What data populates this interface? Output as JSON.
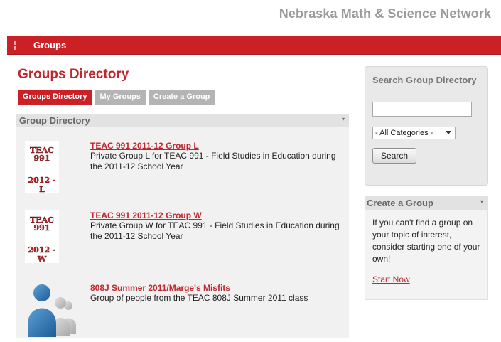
{
  "site": {
    "title": "Nebraska Math & Science Network"
  },
  "nav": {
    "item": "Groups"
  },
  "page": {
    "title": "Groups Directory"
  },
  "tabs": [
    {
      "label": "Groups Directory",
      "active": true
    },
    {
      "label": "My Groups",
      "active": false
    },
    {
      "label": "Create a Group",
      "active": false
    }
  ],
  "directory": {
    "heading": "Group Directory",
    "toggle": "▾",
    "groups": [
      {
        "name": "TEAC 991 2011-12 Group L",
        "description": "Private Group L for TEAC 991 - Field Studies in Education during the 2011-12 School Year",
        "thumb": {
          "line1": "TEAC",
          "line2": "991",
          "line3": "2012 - L"
        }
      },
      {
        "name": "TEAC 991 2011-12 Group W",
        "description": "Private Group W for TEAC 991 - Field Studies in Education during the 2011-12 School Year",
        "thumb": {
          "line1": "TEAC",
          "line2": "991",
          "line3": "2012 - W"
        }
      },
      {
        "name": "808J Summer 2011/Marge's Misfits",
        "description": "Group of people from the TEAC 808J Summer 2011 class",
        "icon": "people-group-icon"
      }
    ]
  },
  "search": {
    "heading": "Search Group Directory",
    "input_value": "",
    "category": "- All Categories -",
    "button": "Search"
  },
  "create": {
    "heading": "Create a Group",
    "toggle": "▾",
    "text": "If you can't find a group on your topic of interest, consider starting one of your own!",
    "link": "Start Now"
  },
  "colors": {
    "brand_red": "#cc2027",
    "tab_gray": "#b4b4b4"
  }
}
